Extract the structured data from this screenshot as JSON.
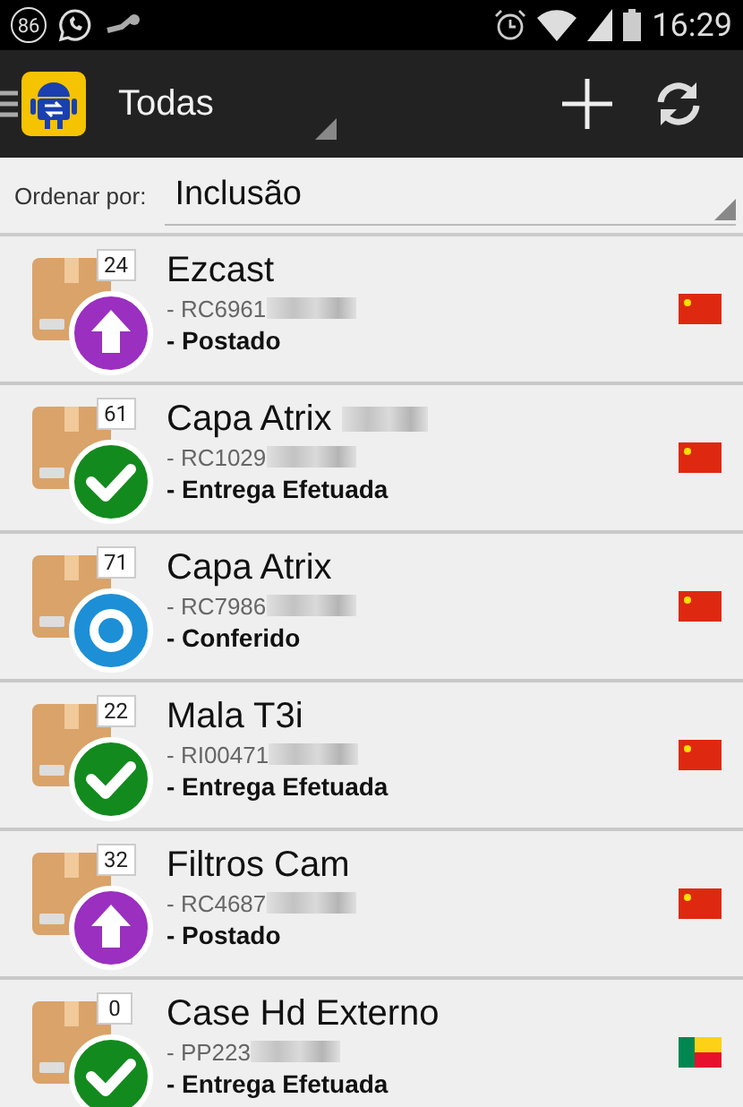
{
  "status_bar": {
    "notification_count": "86",
    "time": "16:29"
  },
  "action_bar": {
    "title": "Todas"
  },
  "sort": {
    "label": "Ordenar por:",
    "value": "Inclusão"
  },
  "items": [
    {
      "name": "Ezcast",
      "name_redacted": false,
      "count": "24",
      "code": "- RC6961",
      "code_redacted": true,
      "status": "- Postado",
      "kind": "posted",
      "flag": {
        "kind": "china"
      }
    },
    {
      "name": "Capa Atrix",
      "name_redacted": true,
      "count": "61",
      "code": "- RC1029",
      "code_redacted": true,
      "status": "- Entrega Efetuada",
      "kind": "delivered",
      "flag": {
        "kind": "china"
      }
    },
    {
      "name": "Capa Atrix",
      "name_redacted": false,
      "count": "71",
      "code": "- RC7986",
      "code_redacted": true,
      "status": "- Conferido",
      "kind": "checked",
      "flag": {
        "kind": "china"
      }
    },
    {
      "name": "Mala T3i",
      "name_redacted": false,
      "count": "22",
      "code": "- RI00471",
      "code_redacted": true,
      "status": "- Entrega Efetuada",
      "kind": "delivered",
      "flag": {
        "kind": "china"
      }
    },
    {
      "name": "Filtros Cam",
      "name_redacted": false,
      "count": "32",
      "code": "- RC4687",
      "code_redacted": true,
      "status": "- Postado",
      "kind": "posted",
      "flag": {
        "kind": "china"
      }
    },
    {
      "name": "Case Hd Externo",
      "name_redacted": false,
      "count": "0",
      "code": "- PP223",
      "code_redacted": true,
      "status": "- Entrega Efetuada",
      "kind": "delivered",
      "flag": {
        "kind": "benin"
      }
    }
  ]
}
